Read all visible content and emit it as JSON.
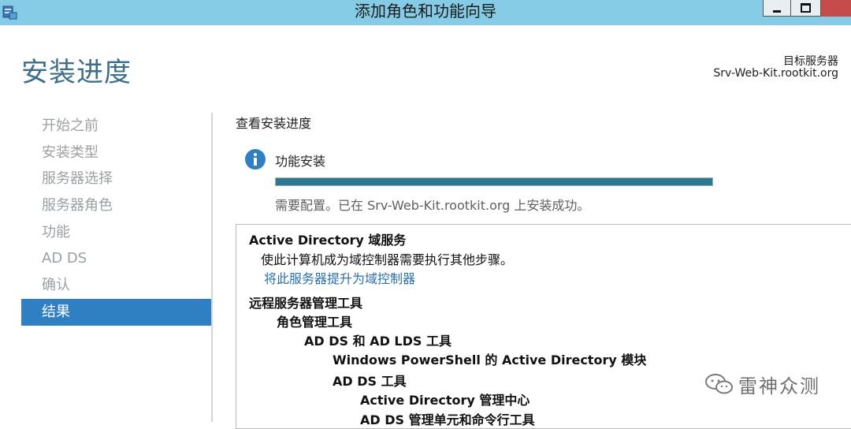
{
  "window": {
    "title": "添加角色和功能向导"
  },
  "header": {
    "page_title": "安装进度",
    "target_label": "目标服务器",
    "target_server": "Srv-Web-Kit.rootkit.org"
  },
  "sidebar": {
    "items": [
      {
        "label": "开始之前",
        "active": false
      },
      {
        "label": "安装类型",
        "active": false
      },
      {
        "label": "服务器选择",
        "active": false
      },
      {
        "label": "服务器角色",
        "active": false
      },
      {
        "label": "功能",
        "active": false
      },
      {
        "label": "AD DS",
        "active": false
      },
      {
        "label": "确认",
        "active": false
      },
      {
        "label": "结果",
        "active": true
      }
    ]
  },
  "main": {
    "section_heading": "查看安装进度",
    "feature_label": "功能安装",
    "progress_percent": 100,
    "status_text": "需要配置。已在 Srv-Web-Kit.rootkit.org 上安装成功。",
    "results": [
      {
        "text": "Active Directory 域服务",
        "style": "bold",
        "level": 0
      },
      {
        "text": "使此计算机成为域控制器需要执行其他步骤。",
        "style": "normal",
        "level": 0
      },
      {
        "text": "将此服务器提升为域控制器",
        "style": "link",
        "level": 0
      },
      {
        "text": "远程服务器管理工具",
        "style": "bold",
        "level": 0
      },
      {
        "text": "角色管理工具",
        "style": "bold",
        "level": 1
      },
      {
        "text": "AD DS 和 AD LDS 工具",
        "style": "bold",
        "level": 2
      },
      {
        "text": "Windows PowerShell 的 Active Directory 模块",
        "style": "bold",
        "level": 3
      },
      {
        "text": "AD DS 工具",
        "style": "bold",
        "level": 3
      },
      {
        "text": "Active Directory 管理中心",
        "style": "bold",
        "level": 4
      },
      {
        "text": "AD DS 管理单元和命令行工具",
        "style": "bold",
        "level": 4
      }
    ]
  },
  "watermark": {
    "text": "雷神众测"
  },
  "colors": {
    "titlebar": "#86cbe6",
    "accent": "#2f80c2",
    "page_title": "#3c6e89",
    "progress_fill": "#2f7791",
    "link": "#2a6ea9",
    "close_button": "#c64b4b"
  },
  "icons": [
    "server-manager-icon",
    "minimize-icon",
    "maximize-icon",
    "close-icon",
    "info-icon",
    "wechat-logo-icon"
  ]
}
